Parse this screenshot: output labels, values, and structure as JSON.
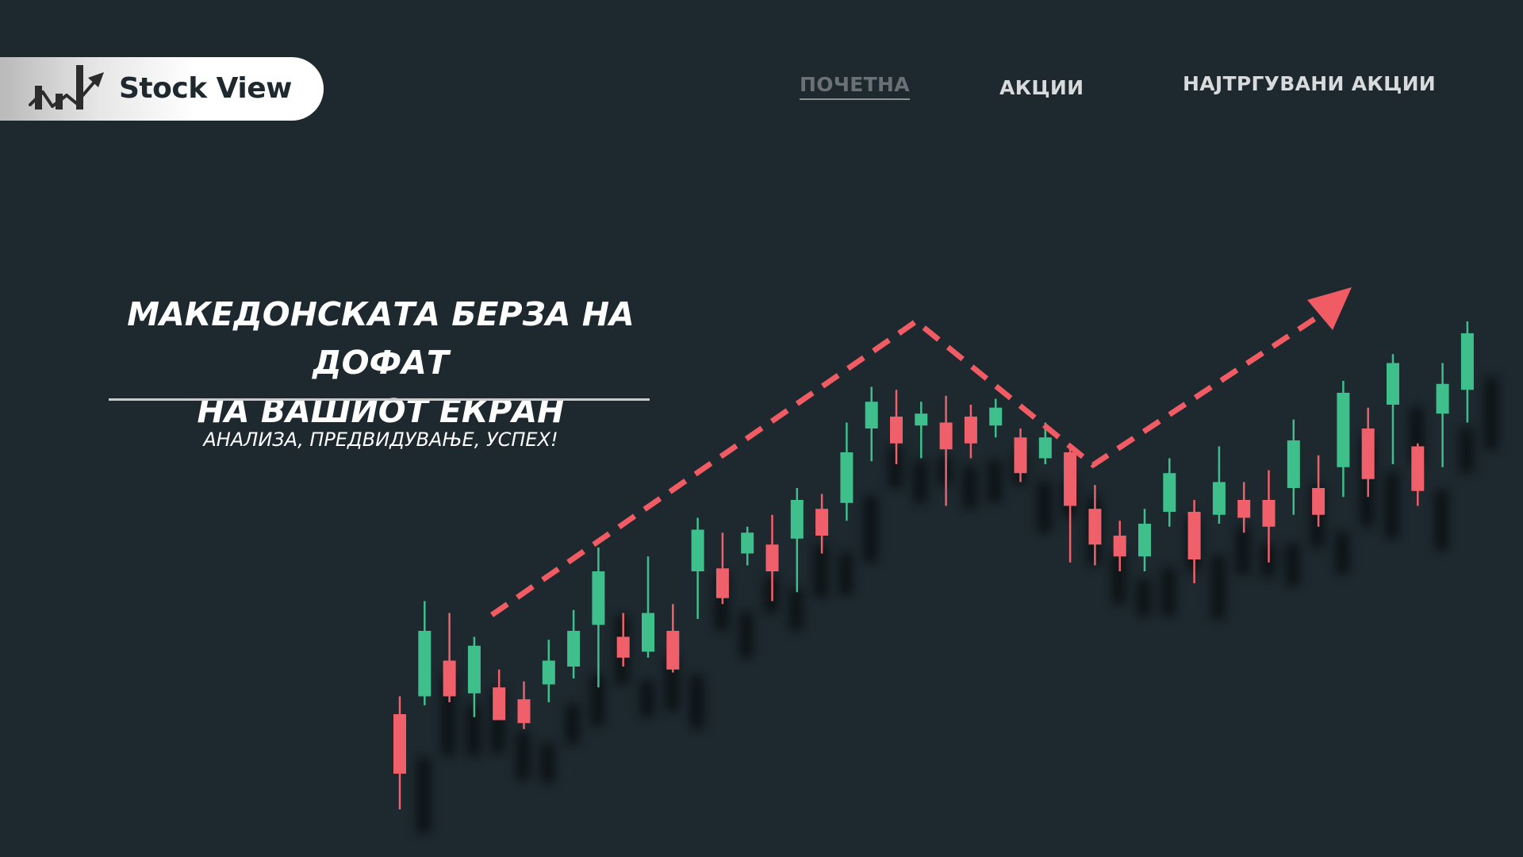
{
  "brand": {
    "name": "Stock View",
    "logo_icon": "rising-chart-icon",
    "pill_color": "#ffffff"
  },
  "nav": {
    "items": [
      {
        "label": "ПОЧЕТНА",
        "active": true
      },
      {
        "label": "АКЦИИ",
        "active": false
      },
      {
        "label": "НАЈТРГУВАНИ АКЦИИ",
        "active": false
      }
    ]
  },
  "hero": {
    "headline_line1": "МАКЕДОНСКАТА БЕРЗА НА ДОФАТ",
    "headline_line2": "НА ВАШИОТ ЕКРАН",
    "tagline": "АНАЛИЗА, ПРЕДВИДУВАЊЕ, УСПЕХ!"
  },
  "theme": {
    "background": "#1d292f",
    "up_color": "#3fbf8b",
    "down_color": "#f0606a",
    "trend_color": "#f05b64"
  },
  "illustration": {
    "type": "candlestick",
    "trend_arrow": "trend-arrow-icon",
    "candles": [
      {
        "d": "down",
        "o": 3.2,
        "c": 1.2,
        "h": 3.8,
        "l": 0.0
      },
      {
        "d": "up",
        "o": 3.8,
        "c": 6.0,
        "h": 7.0,
        "l": 3.5
      },
      {
        "d": "down",
        "o": 5.0,
        "c": 3.8,
        "h": 6.6,
        "l": 3.6
      },
      {
        "d": "up",
        "o": 3.9,
        "c": 5.5,
        "h": 5.8,
        "l": 3.1
      },
      {
        "d": "down",
        "o": 4.1,
        "c": 3.0,
        "h": 4.7,
        "l": 3.0
      },
      {
        "d": "down",
        "o": 3.7,
        "c": 2.9,
        "h": 4.3,
        "l": 2.7
      },
      {
        "d": "up",
        "o": 4.2,
        "c": 5.0,
        "h": 5.7,
        "l": 3.6
      },
      {
        "d": "up",
        "o": 4.8,
        "c": 6.0,
        "h": 6.7,
        "l": 4.4
      },
      {
        "d": "up",
        "o": 6.2,
        "c": 8.0,
        "h": 8.8,
        "l": 4.1
      },
      {
        "d": "down",
        "o": 5.8,
        "c": 5.1,
        "h": 6.6,
        "l": 4.8
      },
      {
        "d": "up",
        "o": 5.3,
        "c": 6.6,
        "h": 8.5,
        "l": 5.1
      },
      {
        "d": "down",
        "o": 6.0,
        "c": 4.7,
        "h": 6.9,
        "l": 4.6
      },
      {
        "d": "up",
        "o": 8.0,
        "c": 9.4,
        "h": 9.8,
        "l": 6.4
      },
      {
        "d": "down",
        "o": 8.1,
        "c": 7.1,
        "h": 9.3,
        "l": 6.9
      },
      {
        "d": "up",
        "o": 8.6,
        "c": 9.3,
        "h": 9.5,
        "l": 8.2
      },
      {
        "d": "down",
        "o": 8.9,
        "c": 8.0,
        "h": 9.9,
        "l": 7.0
      },
      {
        "d": "up",
        "o": 9.1,
        "c": 10.4,
        "h": 10.8,
        "l": 7.3
      },
      {
        "d": "down",
        "o": 10.1,
        "c": 9.2,
        "h": 10.6,
        "l": 8.6
      },
      {
        "d": "up",
        "o": 10.3,
        "c": 12.0,
        "h": 13.0,
        "l": 9.7
      },
      {
        "d": "up",
        "o": 12.8,
        "c": 13.7,
        "h": 14.2,
        "l": 11.7
      },
      {
        "d": "down",
        "o": 13.2,
        "c": 12.3,
        "h": 14.1,
        "l": 11.6
      },
      {
        "d": "up",
        "o": 12.9,
        "c": 13.3,
        "h": 13.7,
        "l": 11.8
      },
      {
        "d": "down",
        "o": 13.0,
        "c": 12.1,
        "h": 13.9,
        "l": 10.2
      },
      {
        "d": "down",
        "o": 13.2,
        "c": 12.3,
        "h": 13.6,
        "l": 11.8
      },
      {
        "d": "up",
        "o": 12.9,
        "c": 13.5,
        "h": 13.8,
        "l": 12.5
      },
      {
        "d": "down",
        "o": 12.5,
        "c": 11.3,
        "h": 12.8,
        "l": 11.0
      },
      {
        "d": "up",
        "o": 11.8,
        "c": 12.5,
        "h": 13.0,
        "l": 11.6
      },
      {
        "d": "down",
        "o": 12.0,
        "c": 10.2,
        "h": 12.2,
        "l": 8.3
      },
      {
        "d": "down",
        "o": 10.1,
        "c": 8.9,
        "h": 10.9,
        "l": 8.2
      },
      {
        "d": "down",
        "o": 9.2,
        "c": 8.5,
        "h": 9.7,
        "l": 8.0
      },
      {
        "d": "up",
        "o": 8.5,
        "c": 9.6,
        "h": 10.1,
        "l": 8.0
      },
      {
        "d": "up",
        "o": 10.0,
        "c": 11.3,
        "h": 11.8,
        "l": 9.5
      },
      {
        "d": "down",
        "o": 10.0,
        "c": 8.4,
        "h": 10.4,
        "l": 7.6
      },
      {
        "d": "up",
        "o": 9.9,
        "c": 11.0,
        "h": 12.2,
        "l": 9.6
      },
      {
        "d": "down",
        "o": 10.4,
        "c": 9.8,
        "h": 11.0,
        "l": 9.3
      },
      {
        "d": "down",
        "o": 10.4,
        "c": 9.5,
        "h": 11.4,
        "l": 8.3
      },
      {
        "d": "up",
        "o": 10.8,
        "c": 12.4,
        "h": 13.1,
        "l": 9.9
      },
      {
        "d": "down",
        "o": 10.8,
        "c": 9.9,
        "h": 11.9,
        "l": 9.5
      },
      {
        "d": "up",
        "o": 11.5,
        "c": 14.0,
        "h": 14.4,
        "l": 10.5
      },
      {
        "d": "down",
        "o": 12.8,
        "c": 11.1,
        "h": 13.5,
        "l": 10.5
      },
      {
        "d": "up",
        "o": 13.6,
        "c": 15.0,
        "h": 15.3,
        "l": 11.6
      },
      {
        "d": "down",
        "o": 12.2,
        "c": 10.7,
        "h": 12.3,
        "l": 10.2
      },
      {
        "d": "up",
        "o": 13.3,
        "c": 14.3,
        "h": 15.0,
        "l": 11.5
      },
      {
        "d": "up",
        "o": 14.1,
        "c": 16.0,
        "h": 16.4,
        "l": 13.0
      }
    ]
  }
}
